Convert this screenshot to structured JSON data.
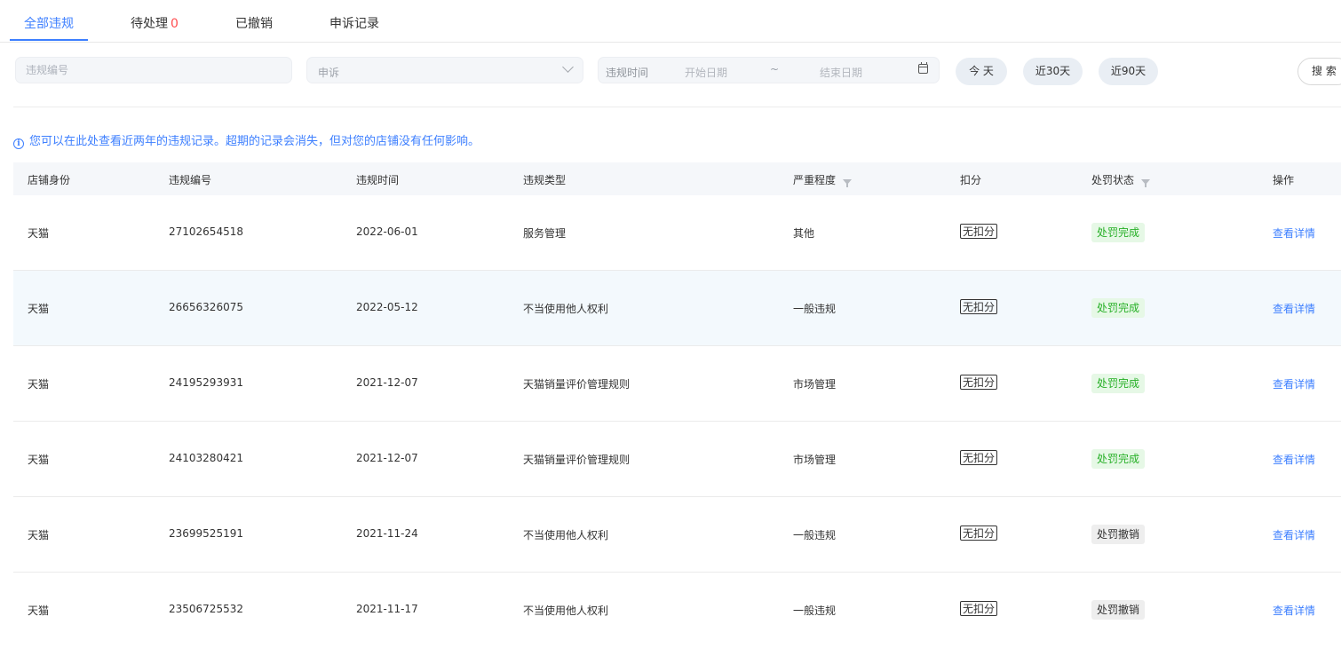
{
  "tabs": [
    {
      "label": "全部违规"
    },
    {
      "label": "待处理",
      "count": "0"
    },
    {
      "label": "已撤销"
    },
    {
      "label": "申诉记录"
    }
  ],
  "filters": {
    "violation_id_placeholder": "违规编号",
    "type_select_value": "申诉",
    "date_label": "违规时间",
    "start_placeholder": "开始日期",
    "range_separator": "~",
    "end_placeholder": "结束日期",
    "quick": [
      "今 天",
      "近30天",
      "近90天"
    ],
    "search_label": "搜 索"
  },
  "notice": "您可以在此处查看近两年的违规记录。超期的记录会消失，但对您的店铺没有任何影响。",
  "table": {
    "columns": [
      "店铺身份",
      "违规编号",
      "违规时间",
      "违规类型",
      "严重程度",
      "扣分",
      "处罚状态",
      "操作"
    ],
    "rows": [
      {
        "identity": "天猫",
        "id": "27102654518",
        "date": "2022-06-01",
        "type": "服务管理",
        "severity": "其他",
        "deduct": "无扣分",
        "status": "处罚完成",
        "status_kind": "done",
        "action": "查看详情"
      },
      {
        "identity": "天猫",
        "id": "26656326075",
        "date": "2022-05-12",
        "type": "不当使用他人权利",
        "severity": "一般违规",
        "deduct": "无扣分",
        "status": "处罚完成",
        "status_kind": "done",
        "action": "查看详情"
      },
      {
        "identity": "天猫",
        "id": "24195293931",
        "date": "2021-12-07",
        "type": "天猫销量评价管理规则",
        "severity": "市场管理",
        "deduct": "无扣分",
        "status": "处罚完成",
        "status_kind": "done",
        "action": "查看详情"
      },
      {
        "identity": "天猫",
        "id": "24103280421",
        "date": "2021-12-07",
        "type": "天猫销量评价管理规则",
        "severity": "市场管理",
        "deduct": "无扣分",
        "status": "处罚完成",
        "status_kind": "done",
        "action": "查看详情"
      },
      {
        "identity": "天猫",
        "id": "23699525191",
        "date": "2021-11-24",
        "type": "不当使用他人权利",
        "severity": "一般违规",
        "deduct": "无扣分",
        "status": "处罚撤销",
        "status_kind": "revoked",
        "action": "查看详情"
      },
      {
        "identity": "天猫",
        "id": "23506725532",
        "date": "2021-11-17",
        "type": "不当使用他人权利",
        "severity": "一般违规",
        "deduct": "无扣分",
        "status": "处罚撤销",
        "status_kind": "revoked",
        "action": "查看详情"
      }
    ]
  },
  "colors": {
    "accent": "#3d7fff",
    "count_red": "#ff4d4f",
    "status_done_bg": "#e6f8e6",
    "status_done_text": "#27b027",
    "status_revoked_bg": "#eeeeee",
    "row_highlight": "#f3f9fd"
  }
}
